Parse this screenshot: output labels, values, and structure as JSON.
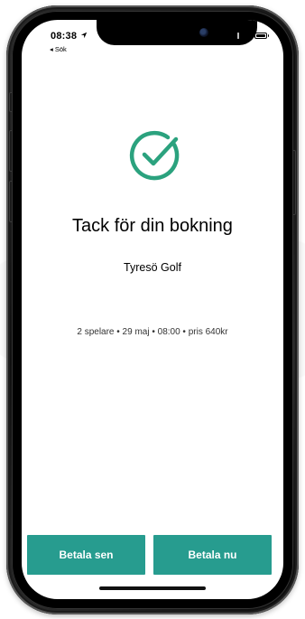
{
  "status_bar": {
    "time": "08:38",
    "back_label": "◂ Sök"
  },
  "confirmation": {
    "icon": "check-circle-icon",
    "title": "Tack för din bokning",
    "club_name": "Tyresö Golf",
    "details": "2 spelare • 29 maj • 08:00 • pris 640kr"
  },
  "actions": {
    "pay_later_label": "Betala sen",
    "pay_now_label": "Betala nu"
  },
  "colors": {
    "accent": "#279c8f",
    "check": "#2ba27e"
  }
}
